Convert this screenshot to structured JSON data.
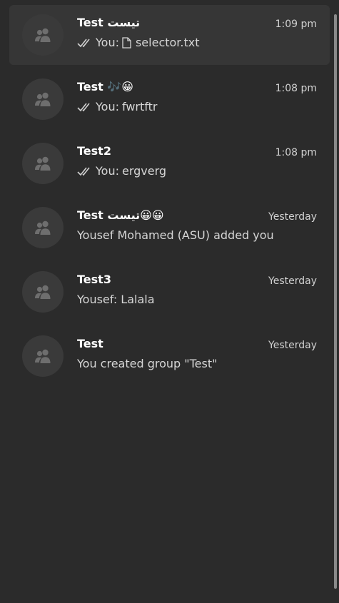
{
  "chats": [
    {
      "title": "Test تيست",
      "time": "1:09 pm",
      "sender": "You:",
      "message": "selector.txt",
      "read_receipt": "double-check-icon",
      "attachment_icon": "file-icon",
      "selected": true
    },
    {
      "title": "Test 🎶😀",
      "time": "1:08 pm",
      "sender": "You:",
      "message": "fwrtftr",
      "read_receipt": "double-check-icon"
    },
    {
      "title": "Test2",
      "time": "1:08 pm",
      "sender": "You:",
      "message": "ergverg",
      "read_receipt": "double-check-icon"
    },
    {
      "title": "Test تيست😀😀",
      "time": "Yesterday",
      "message": "Yousef Mohamed (ASU) added you"
    },
    {
      "title": "Test3",
      "time": "Yesterday",
      "message": "Yousef: Lalala"
    },
    {
      "title": "Test",
      "time": "Yesterday",
      "message": "You created group \"Test\""
    }
  ],
  "avatar_icon": "group-icon",
  "colors": {
    "background": "#2b2b2b",
    "selected_row": "#363636",
    "avatar_bg": "#3a3a3a",
    "avatar_fg": "#6e6e6e"
  }
}
